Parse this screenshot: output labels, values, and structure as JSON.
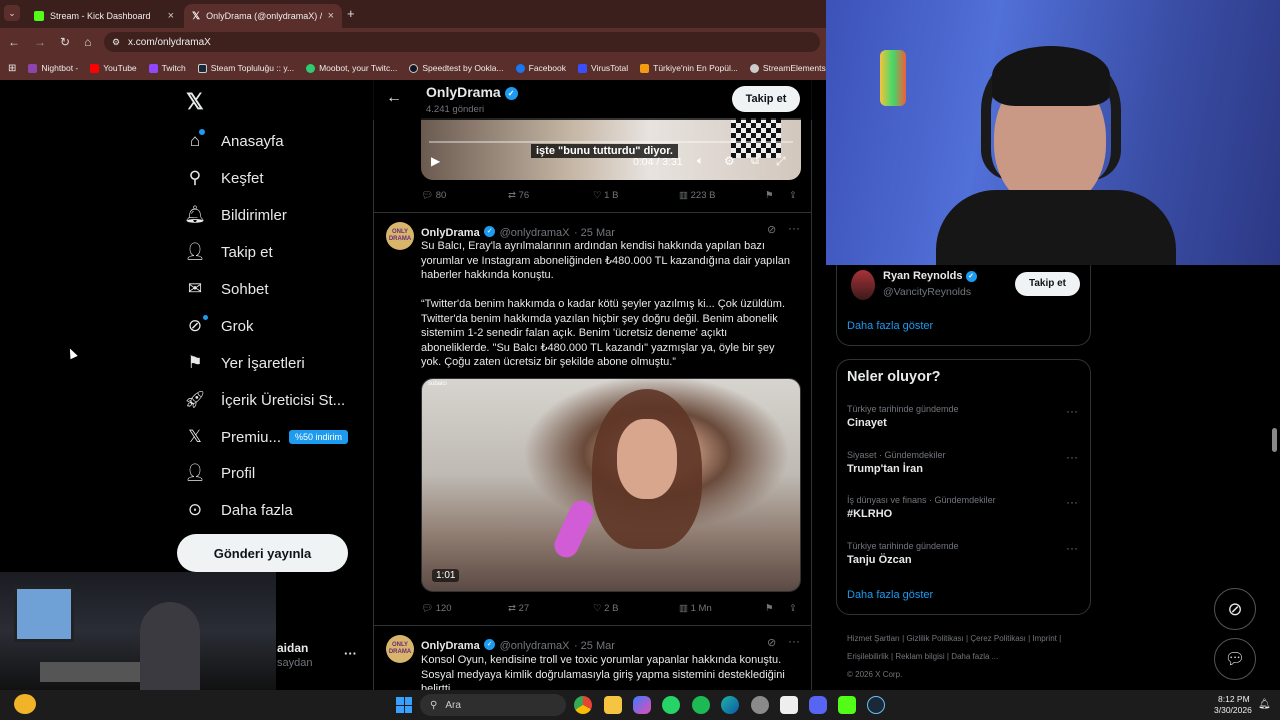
{
  "browser": {
    "tabs": [
      {
        "label": "Stream - Kick Dashboard"
      },
      {
        "label": "OnlyDrama (@onlydramaX) / X"
      }
    ],
    "new_tab": "+",
    "url": "x.com/onlydramaX",
    "bookmarks": [
      {
        "label": "Nightbot -",
        "color": "#8e44ad"
      },
      {
        "label": "YouTube",
        "color": "#ff0000"
      },
      {
        "label": "Twitch",
        "color": "#9146ff"
      },
      {
        "label": "Steam Topluluğu :: y...",
        "color": "#1b2838"
      },
      {
        "label": "Moobot, your Twitc...",
        "color": "#2ecc71"
      },
      {
        "label": "Speedtest by Ookla...",
        "color": "#141526"
      },
      {
        "label": "Facebook",
        "color": "#1877f2"
      },
      {
        "label": "VirusTotal",
        "color": "#394eff"
      },
      {
        "label": "Türkiye'nin En Popül...",
        "color": "#f39c12"
      },
      {
        "label": "StreamElements",
        "color": "#cccccc"
      }
    ]
  },
  "nav": {
    "items": [
      {
        "label": "Anasayfa",
        "icon": "home-icon"
      },
      {
        "label": "Keşfet",
        "icon": "search-icon"
      },
      {
        "label": "Bildirimler",
        "icon": "bell-icon"
      },
      {
        "label": "Takip et",
        "icon": "person-add-icon"
      },
      {
        "label": "Sohbet",
        "icon": "mail-icon"
      },
      {
        "label": "Grok",
        "icon": "grok-icon"
      },
      {
        "label": "Yer İşaretleri",
        "icon": "bookmark-icon"
      },
      {
        "label": "İçerik Üreticisi St...",
        "icon": "rocket-icon"
      },
      {
        "label": "Premiu...",
        "icon": "x-logo-icon"
      },
      {
        "label": "Profil",
        "icon": "person-icon"
      },
      {
        "label": "Daha fazla",
        "icon": "more-circle-icon"
      }
    ],
    "premium_badge": "%50 indirim",
    "post_button": "Gönderi yayınla",
    "account_name": "aidan",
    "account_handle": "saydan",
    "account_more": "···"
  },
  "profile_header": {
    "name": "OnlyDrama",
    "posts": "4.241 gönderi",
    "follow": "Takip et"
  },
  "video1": {
    "caption": "işte \"bunu tutturdu\" diyor.",
    "time": "0:04 / 3:31"
  },
  "tweet0_actions": {
    "replies": "80",
    "retweets": "76",
    "likes": "1 B",
    "views": "223 B"
  },
  "tweet1": {
    "name": "OnlyDrama",
    "handle": "@onlydramaX",
    "date": "· 25 Mar",
    "p1": "Su Balcı, Eray'la ayrılmalarının ardından kendisi hakkında yapılan bazı yorumlar ve Instagram aboneliğinden ₺480.000 TL kazandığına dair yapılan haberler hakkında konuştu.",
    "p2": "“Twitter'da benim hakkımda o kadar kötü şeyler yazılmış ki... Çok üzüldüm. Twitter'da benim hakkımda yazılan hiçbir şey doğru değil. Benim abonelik sistemim 1-2 senedir falan açık. Benim 'ücretsiz deneme' açıktı aboneliklerde. \"Su Balcı ₺480.000 TL kazandı\" yazmışlar ya, öyle bir şey yok. Çoğu zaten ücretsiz bir şekilde abone olmuştu.”",
    "video_tag": "subalci",
    "video_time": "1:01",
    "replies": "120",
    "retweets": "27",
    "likes": "2 B",
    "views": "1 Mn"
  },
  "tweet2": {
    "name": "OnlyDrama",
    "handle": "@onlydramaX",
    "date": "· 25 Mar",
    "text": "Konsol Oyun, kendisine troll ve toxic yorumlar yapanlar hakkında konuştu. Sosyal medyaya kimlik doğrulamasıyla giriş yapma sistemini desteklediğini belirtti."
  },
  "avatar_text": "ONLY DRAMA",
  "who_to_follow": {
    "name": "Ryan Reynolds",
    "handle": "@VancityReynolds",
    "follow": "Takip et",
    "more": "Daha fazla göster"
  },
  "trends": {
    "title": "Neler oluyor?",
    "items": [
      {
        "category": "Türkiye tarihinde gündemde",
        "title": "Cinayet"
      },
      {
        "category": "Siyaset · Gündemdekiler",
        "title": "Trump'tan İran"
      },
      {
        "category": "İş dünyası ve finans · Gündemdekiler",
        "title": "#KLRHO"
      },
      {
        "category": "Türkiye tarihinde gündemde",
        "title": "Tanju Özcan"
      }
    ],
    "more": "Daha fazla göster"
  },
  "footer": {
    "links": [
      "Hizmet Şartları",
      "Gizlilik Politikası",
      "Çerez Politikası",
      "Imprint",
      "Erişilebilirlik",
      "Reklam bilgisi",
      "Daha fazla ..."
    ],
    "copyright": "© 2026 X Corp."
  },
  "taskbar": {
    "search": "Ara",
    "time": "8:12 PM",
    "date": "3/30/2026"
  }
}
